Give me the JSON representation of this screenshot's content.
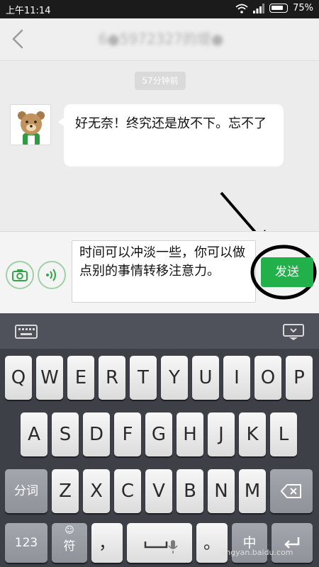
{
  "status_bar": {
    "time": "上午11:14",
    "battery": "75%"
  },
  "header": {
    "title": "6●5972327的堤●"
  },
  "chat": {
    "timestamp": "57分钟前",
    "message": "好无奈！终究还是放不下。忘不了"
  },
  "input": {
    "text": "时间可以冲淡一些，你可以做点别的事情转移注意力。",
    "send_label": "发送"
  },
  "keyboard": {
    "row1": [
      "Q",
      "W",
      "E",
      "R",
      "T",
      "Y",
      "U",
      "I",
      "O",
      "P"
    ],
    "row2": [
      "A",
      "S",
      "D",
      "F",
      "G",
      "H",
      "J",
      "K",
      "L"
    ],
    "row3_left": "分词",
    "row3": [
      "Z",
      "X",
      "C",
      "V",
      "B",
      "N",
      "M"
    ],
    "row4_numeric": "123",
    "row4_symbol": "符",
    "row4_comma": "，",
    "row4_period": "。",
    "row4_lang": "中"
  },
  "watermark": "jingyan.baidu.com",
  "colors": {
    "send_green": "#21b04a",
    "status_bar": "#1b1b1b"
  }
}
